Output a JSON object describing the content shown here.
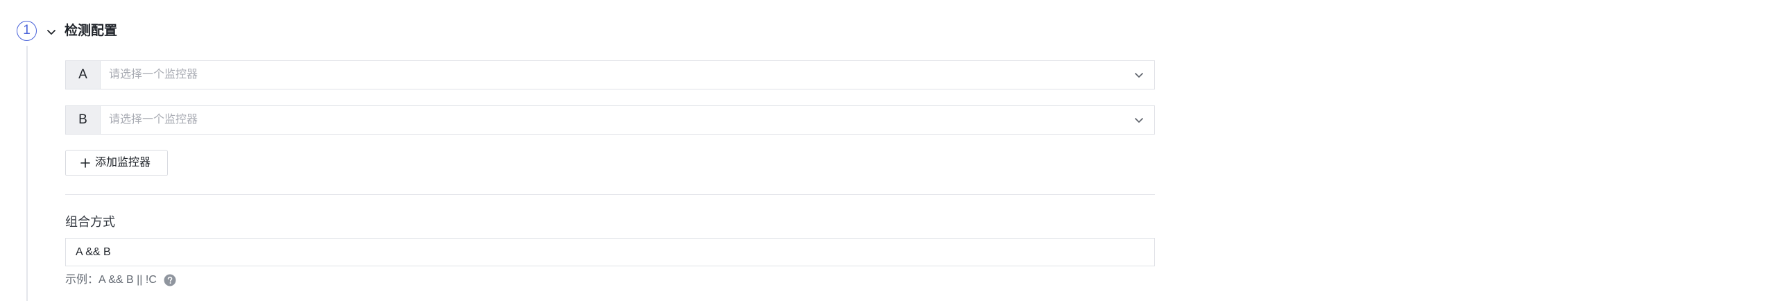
{
  "step": {
    "number": "1",
    "title": "检测配置"
  },
  "monitors": [
    {
      "label": "A",
      "placeholder": "请选择一个监控器"
    },
    {
      "label": "B",
      "placeholder": "请选择一个监控器"
    }
  ],
  "add_monitor_label": "添加监控器",
  "combine": {
    "label": "组合方式",
    "value": "A && B",
    "hint": "示例：A && B || !C"
  },
  "colors": {
    "accent": "#4a63d9",
    "border": "#dfe1e6",
    "label_bg": "#eeeff2",
    "placeholder": "#a8abb3"
  },
  "icons": {
    "toggle": "chevron-down-icon",
    "select": "chevron-down-icon",
    "add": "plus-icon",
    "help": "question-circle-icon"
  }
}
